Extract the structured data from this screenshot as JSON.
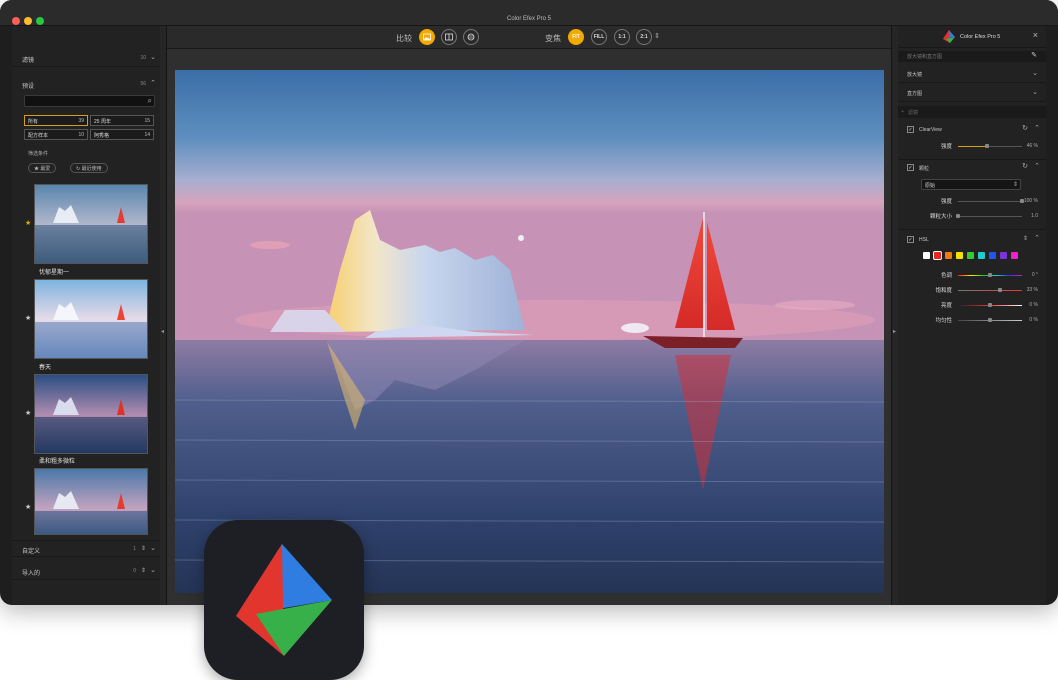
{
  "window": {
    "title": "Color Efex Pro 5"
  },
  "toolbar": {
    "compare_label": "比较",
    "zoom_label": "变焦",
    "zoom_fit": "FIT",
    "zoom_fill": "FILL",
    "zoom_1to1": "1:1",
    "zoom_2to1": "2:1"
  },
  "left": {
    "filters": {
      "label": "滤镜",
      "count": "10"
    },
    "presets": {
      "label": "预设",
      "count": "56"
    },
    "search": {
      "placeholder": ""
    },
    "categories": [
      {
        "name": "所有",
        "count": "39"
      },
      {
        "name": "25 周年",
        "count": "15"
      },
      {
        "name": "配方样本",
        "count": "10"
      },
      {
        "name": "阿秀格",
        "count": "14"
      }
    ],
    "filter_conditions_label": "筛选条件",
    "pills": [
      "★ 最爱",
      "↻ 最近使用"
    ],
    "presets_list": [
      {
        "name": "忧郁星期一"
      },
      {
        "name": "春天"
      },
      {
        "name": "柔和粗多微粒"
      },
      {
        "name": ""
      }
    ],
    "custom": {
      "label": "自定义",
      "count": "1"
    },
    "imported": {
      "label": "导入的",
      "count": "0"
    }
  },
  "right": {
    "brand": "Color Efex Pro 5",
    "top_note": "放大镜和直方图",
    "sections": [
      {
        "label": "放大镜"
      },
      {
        "label": "直方图"
      }
    ],
    "filters_header": "滤镜",
    "clearview": {
      "name": "ClearView",
      "strength_label": "强度",
      "strength_value": "46 %",
      "strength": 0.46
    },
    "grain": {
      "name": "颗粒",
      "dropdown": "原始",
      "strength_label": "强度",
      "strength_value": "100 %",
      "strength": 1.0,
      "size_label": "颗粒大小",
      "size_value": "1.0",
      "size": 0.0
    },
    "hsl": {
      "name": "HSL",
      "colors": [
        "#ffffff",
        "#e8251f",
        "#f07a12",
        "#f3e200",
        "#33cc33",
        "#22cccc",
        "#2255ee",
        "#7a33dd",
        "#ee22cc"
      ],
      "rows": [
        {
          "label": "色调",
          "value": "0 °",
          "level": 0.5
        },
        {
          "label": "饱和度",
          "value": "33 %",
          "level": 0.66
        },
        {
          "label": "亮度",
          "value": "0 %",
          "level": 0.5
        },
        {
          "label": "均匀性",
          "value": "0 %",
          "level": 0.5
        }
      ]
    }
  }
}
